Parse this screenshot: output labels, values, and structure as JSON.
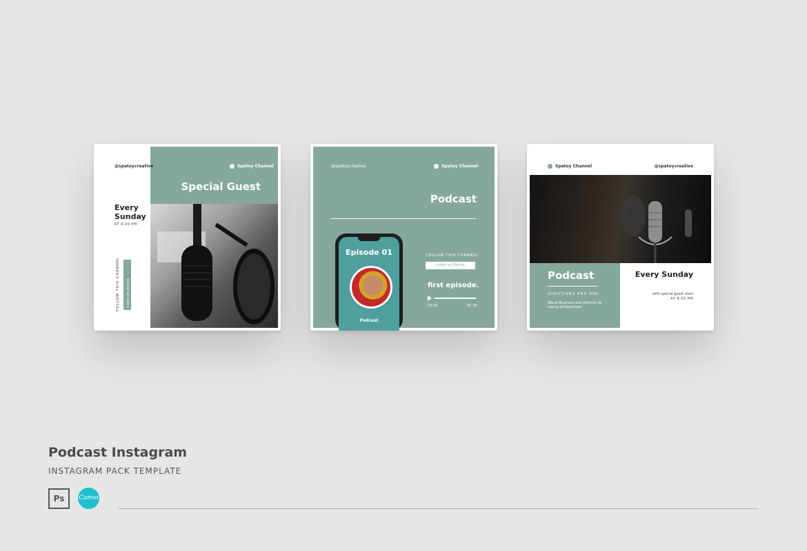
{
  "colors": {
    "background": "#e6e6e6",
    "teal": "#86a79e",
    "phone_screen": "#4f9f9d",
    "canva": "#1fbfcf"
  },
  "card1": {
    "handle": "@spatoycreative",
    "brand": "Spatoy Channel",
    "title": "Special Guest",
    "every": "Every Sunday",
    "time": "AT 8.00 PM",
    "follow": "FOLLOW THIS CHANNEL",
    "listen": "Listen on Device"
  },
  "card2": {
    "handle": "@spatoycreative",
    "brand": "Spatoy Channel",
    "title": "Podcast",
    "episode": "Episode 01",
    "phone_label": "Podcast",
    "follow": "FOLLOW THIS CHANNEL",
    "listen": "Listen on Device",
    "first": "first episode.",
    "time_start": "03:45",
    "time_end": "05:33"
  },
  "card3": {
    "brand": "Spatoy Channel",
    "handle": "@spatoycreative",
    "title": "Podcast",
    "questions": "QUESTIONS AND ASK",
    "desc": "About Business and lifestyle for young entrepreneur",
    "every": "Every Sunday",
    "stars": "with special guest stars",
    "at": "AT 8.00 PM"
  },
  "footer": {
    "title": "Podcast Instagram",
    "subtitle": "INSTAGRAM PACK TEMPLATE",
    "ps": "Ps",
    "canva": "Canva"
  },
  "icons": [
    "photoshop-icon",
    "canva-icon",
    "play-icon",
    "dot-icon"
  ]
}
